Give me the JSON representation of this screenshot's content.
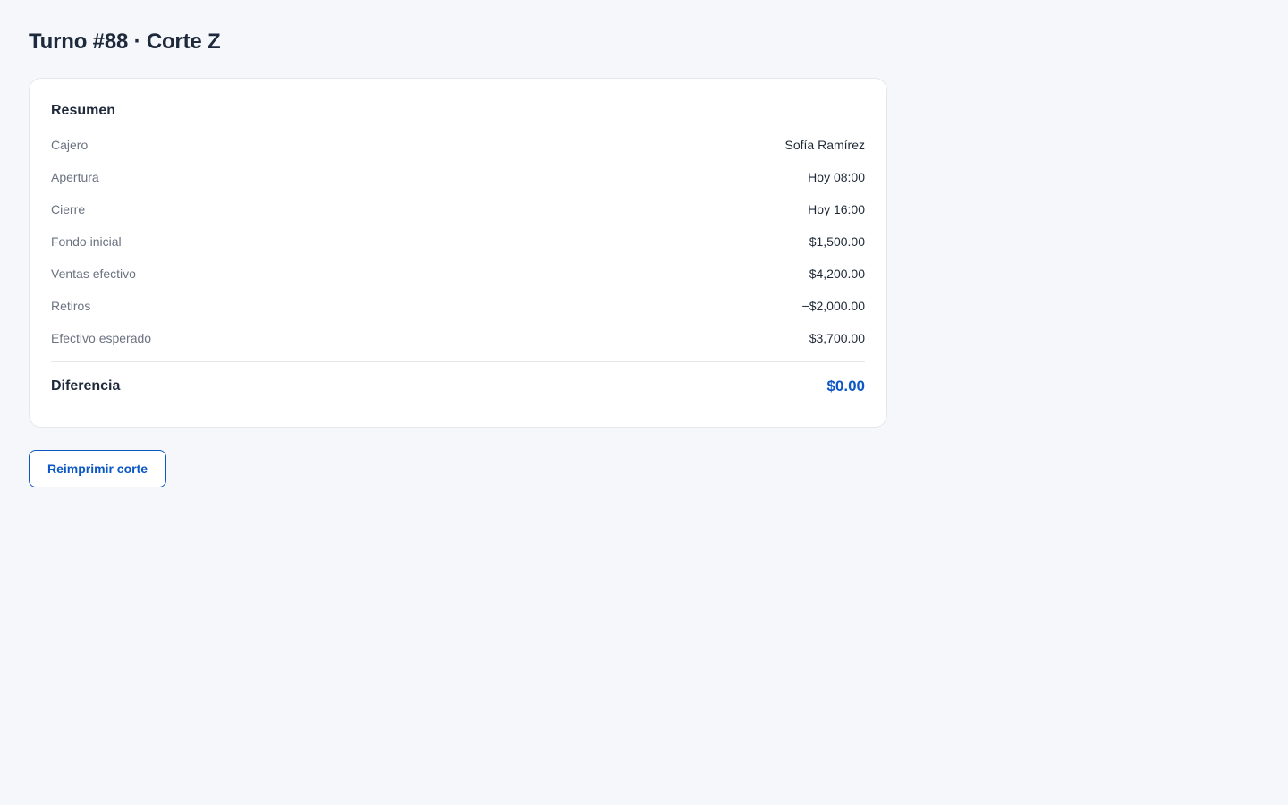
{
  "page": {
    "title": "Turno #88 · Corte Z"
  },
  "summary": {
    "title": "Resumen",
    "rows": [
      {
        "label": "Cajero",
        "value": "Sofía Ramírez"
      },
      {
        "label": "Apertura",
        "value": "Hoy 08:00"
      },
      {
        "label": "Cierre",
        "value": "Hoy 16:00"
      },
      {
        "label": "Fondo inicial",
        "value": "$1,500.00"
      },
      {
        "label": "Ventas efectivo",
        "value": "$4,200.00"
      },
      {
        "label": "Retiros",
        "value": "−$2,000.00"
      },
      {
        "label": "Efectivo esperado",
        "value": "$3,700.00"
      }
    ],
    "total": {
      "label": "Diferencia",
      "value": "$0.00"
    }
  },
  "actions": {
    "reprint_label": "Reimprimir corte"
  },
  "colors": {
    "accent": "#0b57c5",
    "background": "#f5f7fb"
  }
}
